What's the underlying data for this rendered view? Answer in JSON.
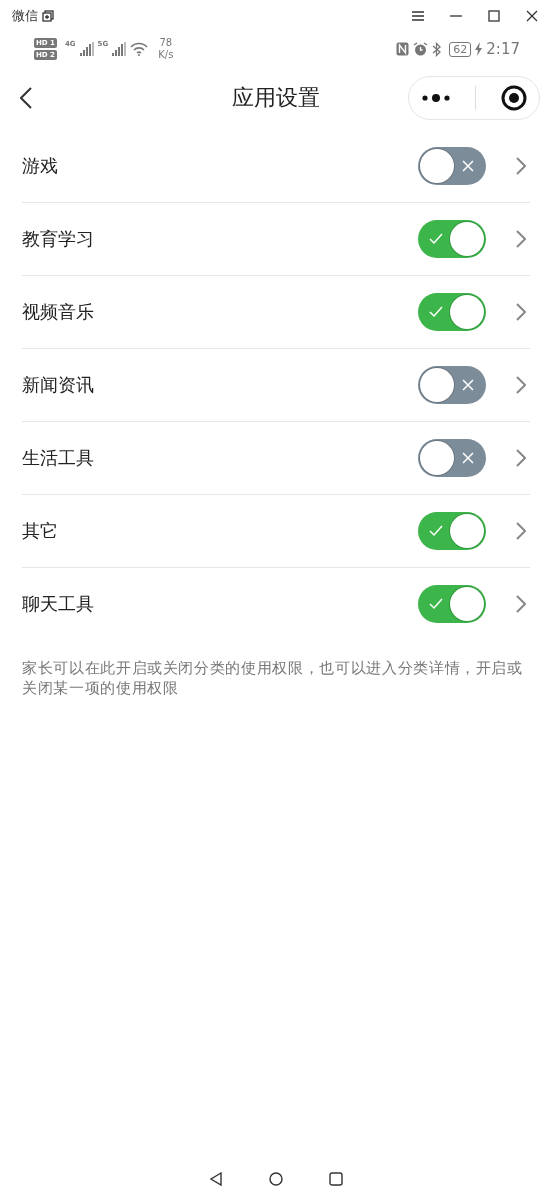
{
  "window": {
    "title": "微信"
  },
  "status_bar": {
    "sims": [
      {
        "label": "HD",
        "slot": "1"
      },
      {
        "label": "HD",
        "slot": "2"
      }
    ],
    "networks": [
      "4G",
      "5G"
    ],
    "speed": "78",
    "speed_unit": "K/s",
    "battery": "62",
    "time": "2:17"
  },
  "nav": {
    "title": "应用设置"
  },
  "categories": [
    {
      "name": "游戏",
      "on": false
    },
    {
      "name": "教育学习",
      "on": true
    },
    {
      "name": "视频音乐",
      "on": true
    },
    {
      "name": "新闻资讯",
      "on": false
    },
    {
      "name": "生活工具",
      "on": false
    },
    {
      "name": "其它",
      "on": true
    },
    {
      "name": "聊天工具",
      "on": true
    }
  ],
  "note": "家长可以在此开启或关闭分类的使用权限，也可以进入分类详情，开启或关闭某一项的使用权限"
}
